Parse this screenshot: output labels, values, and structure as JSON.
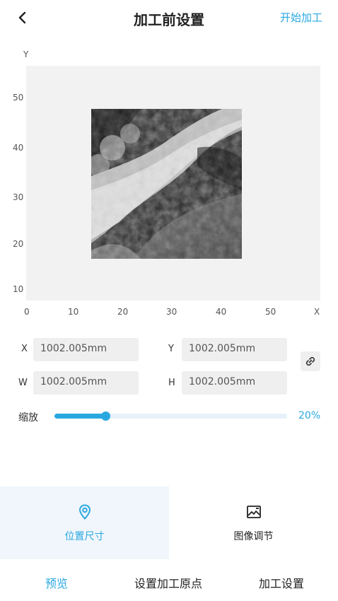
{
  "header": {
    "back_icon": "chevron-left-icon",
    "title": "加工前设置",
    "start_label": "开始加工"
  },
  "canvas": {
    "x_axis_name": "X",
    "y_axis_name": "Y",
    "x_ticks": [
      "0",
      "10",
      "20",
      "30",
      "40",
      "50"
    ],
    "y_ticks": [
      "50",
      "40",
      "30",
      "20",
      "10"
    ]
  },
  "fields": {
    "x": {
      "label": "X",
      "value": "1002.005mm"
    },
    "y": {
      "label": "Y",
      "value": "1002.005mm"
    },
    "w": {
      "label": "W",
      "value": "1002.005mm"
    },
    "h": {
      "label": "H",
      "value": "1002.005mm"
    },
    "link_icon": "link-icon"
  },
  "zoom": {
    "label": "缩放",
    "value_text": "20%",
    "fraction": 0.22
  },
  "tools": [
    {
      "label": "位置尺寸",
      "icon": "location-pin-icon",
      "active": true
    },
    {
      "label": "图像调节",
      "icon": "image-adjust-icon",
      "active": false
    }
  ],
  "bottom_bar": {
    "preview": "预览",
    "set_origin": "设置加工原点",
    "process_settings": "加工设置"
  },
  "colors": {
    "accent": "#29a8e0"
  }
}
